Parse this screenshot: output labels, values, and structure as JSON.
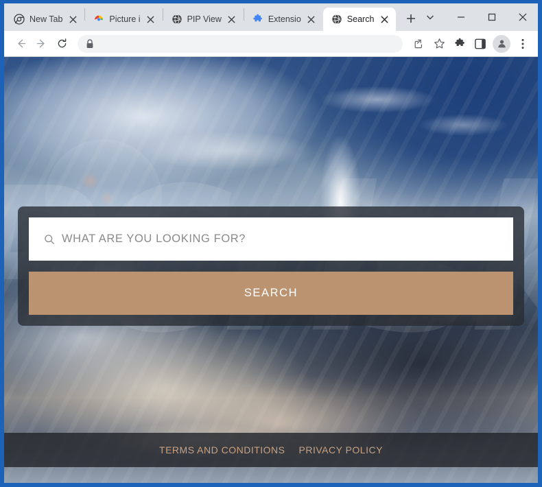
{
  "window": {
    "controls": {
      "tab_search": "chevron-down-icon",
      "minimize": "minimize-icon",
      "maximize": "maximize-icon",
      "close": "close-icon"
    }
  },
  "tabs": [
    {
      "label": "New Tab",
      "favicon": "chrome-logo-icon",
      "active": false
    },
    {
      "label": "Picture i",
      "favicon": "chrome-color-icon",
      "active": false
    },
    {
      "label": "PIP View",
      "favicon": "globe-icon",
      "active": false
    },
    {
      "label": "Extensio",
      "favicon": "puzzle-icon",
      "active": false
    },
    {
      "label": "Search",
      "favicon": "globe-icon",
      "active": true
    }
  ],
  "newtab_button": "new-tab-icon",
  "toolbar": {
    "back": "back-arrow-icon",
    "forward": "forward-arrow-icon",
    "reload": "reload-icon",
    "omnibox": {
      "lock": "lock-icon",
      "value": "",
      "placeholder": ""
    },
    "share": "share-icon",
    "bookmark": "star-icon",
    "extensions": "puzzle-icon",
    "side_panel": "side-panel-icon",
    "profile": "avatar-icon",
    "menu": "three-dot-menu-icon"
  },
  "page": {
    "watermark": "PCrisk",
    "search": {
      "search_icon": "search-icon",
      "placeholder": "WHAT ARE YOU LOOKING FOR?",
      "value": "",
      "button_label": "SEARCH"
    },
    "footer": {
      "links": [
        {
          "label": "TERMS AND CONDITIONS"
        },
        {
          "label": "PRIVACY POLICY"
        }
      ]
    },
    "colors": {
      "accent": "#bc9370",
      "panel": "#282c32",
      "footer_link": "#c9a282",
      "window_border": "#1c62b9"
    }
  }
}
